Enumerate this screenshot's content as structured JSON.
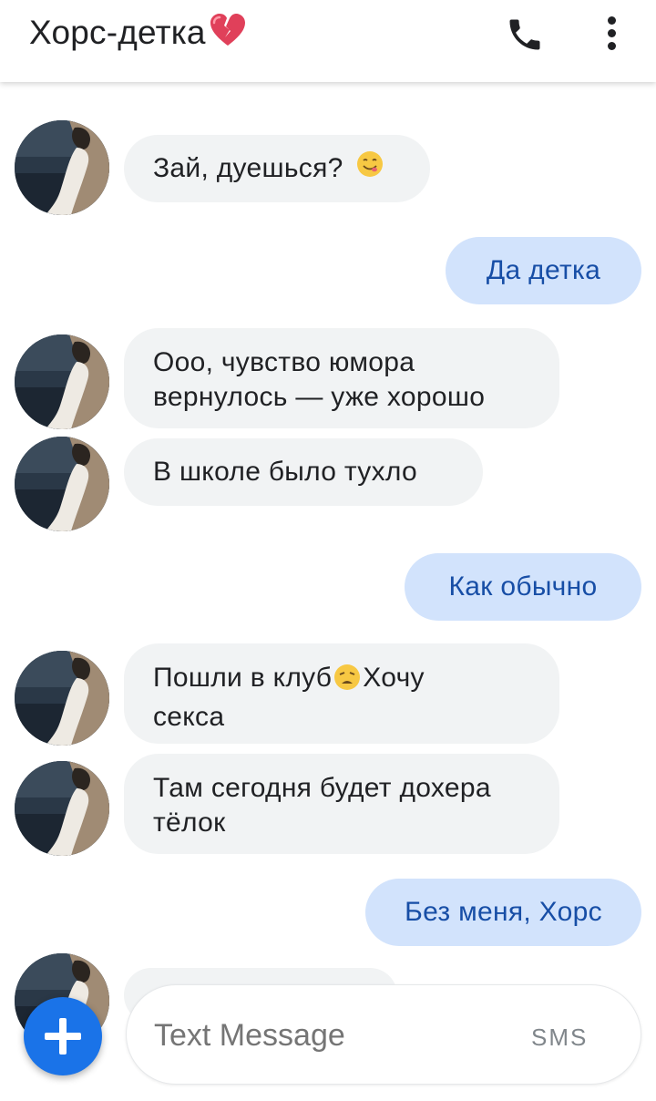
{
  "header": {
    "title": "Хорс-детка",
    "title_emoji": "broken-heart-icon"
  },
  "messages": [
    {
      "direction": "incoming",
      "text": "Зай, дуешься?",
      "emoji": "smiling-face-icon"
    },
    {
      "direction": "outgoing",
      "text": "Да детка"
    },
    {
      "direction": "incoming",
      "lines": [
        "Ооо, чувство юмора",
        "вернулось — уже хорошо"
      ]
    },
    {
      "direction": "incoming",
      "text": "В школе было тухло"
    },
    {
      "direction": "outgoing",
      "text": "Как обычно"
    },
    {
      "direction": "incoming",
      "line1_a": "Пошли в клуб",
      "emoji": "weary-face-icon",
      "line1_b": "Хочу",
      "line2": "секса"
    },
    {
      "direction": "incoming",
      "lines": [
        "Там сегодня будет дохера",
        "тёлок"
      ]
    },
    {
      "direction": "outgoing",
      "text": "Без меня, Хорс"
    }
  ],
  "compose": {
    "placeholder": "Text Message",
    "sms_label": "SMS"
  },
  "colors": {
    "incoming_bubble": "#f1f3f4",
    "outgoing_bubble": "#d2e3fc",
    "outgoing_text": "#174ea6",
    "fab": "#1a73e8"
  }
}
